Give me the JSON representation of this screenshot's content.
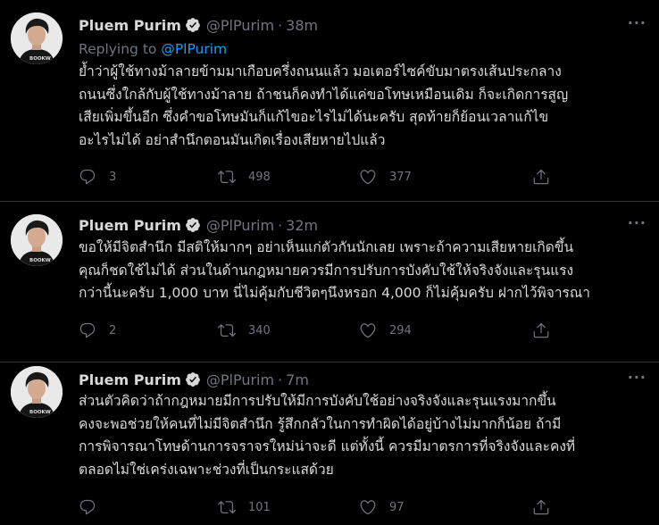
{
  "colors": {
    "background": "#000000",
    "text": "#d9d9d9",
    "muted": "#6e767d",
    "accent": "#1d9bf0",
    "divider": "#2f3336"
  },
  "tweets": [
    {
      "author_name": "Pluem Purim",
      "handle": "@PlPurim",
      "separator": "·",
      "time": "38m",
      "more": "···",
      "replying_prefix": "Replying to",
      "replying_handle": "@PlPurim",
      "text": "ย้ำว่าผู้ใช้ทางม้าลายข้ามมาเกือบครึ่งถนนแล้ว มอเตอร์ไซค์ขับมาตรงเส้นประกลาง\nถนนซึ่งใกล้กับผู้ใช้ทางม้าลาย ถ้าชนก็คงทำได้แค่ขอโทษเหมือนเดิม ก็จะเกิดการสูญ\nเสียเพิ่มขึ้นอีก ซึ่งคำขอโทษมันก็แก้ไขอะไรไม่ได้นะครับ สุดท้ายก็ย้อนเวลาแก้ไข\nอะไรไม่ได้ อย่าสำนึกตอนมันเกิดเรื่องเสียหายไปแล้ว",
      "replies": "3",
      "retweets": "498",
      "likes": "377",
      "icons": [
        "reply-icon",
        "retweet-icon",
        "like-icon",
        "share-icon"
      ]
    },
    {
      "author_name": "Pluem Purim",
      "handle": "@PlPurim",
      "separator": "·",
      "time": "32m",
      "more": "···",
      "text": "ขอให้มีจิตสำนึก มีสติให้มากๆ อย่าเห็นแก่ตัวกันนักเลย เพราะถ้าความเสียหายเกิดขึ้น\nคุณก็ชดใช้ไม่ได้ ส่วนในด้านกฎหมายควรมีการปรับการบังคับใช้ให้จริงจังและรุนแรง\nกว่านี้นะครับ 1,000 บาท นี่ไม่คุ้มกับชีวิตๆนึงหรอก 4,000 ก็ไม่คุ้มครับ ฝากไว้พิจารณา",
      "replies": "2",
      "retweets": "340",
      "likes": "294"
    },
    {
      "author_name": "Pluem Purim",
      "handle": "@PlPurim",
      "separator": "·",
      "time": "7m",
      "more": "···",
      "text": "ส่วนตัวคิดว่าถ้ากฎหมายมีการปรับให้มีการบังคับใช้อย่างจริงจังและรุนแรงมากขึ้น\nคงจะพอช่วยให้คนที่ไม่มีจิตสำนึก รู้สึกกลัวในการทำผิดได้อยู่บ้างไม่มากก็น้อย ถ้ามี\nการพิจารณาโทษด้านการจราจรใหม่น่าจะดี แต่ทั้งนี้ ควรมีมาตรการที่จริงจังและคงที่\nตลอดไม่ใช่เคร่งเฉพาะช่วงที่เป็นกระแสด้วย",
      "replies": "",
      "retweets": "101",
      "likes": "97"
    }
  ]
}
